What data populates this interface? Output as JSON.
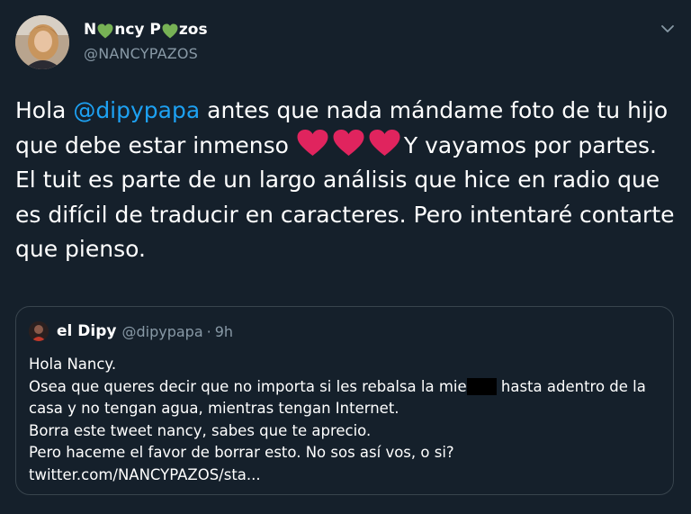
{
  "tweet": {
    "author": {
      "name_part1": "N",
      "name_part2": "ncy P",
      "name_part3": "zos",
      "handle": "@NANCYPAZOS"
    },
    "body": {
      "line1_pre": "Hola ",
      "mention": "@dipypapa",
      "line1_post": " antes que nada mándame foto de tu hijo que debe estar inmenso ",
      "after_hearts": "Y vayamos por partes.",
      "paragraph2": "El tuit es parte de un largo análisis que hice en radio que es difícil de traducir en caracteres. Pero intentaré contarte que pienso."
    },
    "hearts_color": "#e0245e",
    "name_hearts_color": "#77b255"
  },
  "quoted": {
    "name": "el Dipy",
    "handle": "@dipypapa",
    "dot": "·",
    "time": "9h",
    "lines": {
      "l1": "Hola Nancy.",
      "l2_pre": "Osea que queres decir que no importa si les rebalsa la mie",
      "l2_post": " hasta adentro de la casa y no tengan agua, mientras tengan Internet.",
      "l3": "Borra este tweet nancy, sabes que te aprecio.",
      "l4": "Pero haceme el favor de borrar esto. No sos así vos, o si?",
      "l5": "twitter.com/NANCYPAZOS/sta..."
    }
  },
  "colors": {
    "background": "#15202b",
    "text": "#ffffff",
    "secondary": "#8899a6",
    "link": "#1da1f2",
    "border": "#38444d"
  },
  "icons": {
    "menu": "chevron-down-icon",
    "heart": "heart-icon"
  }
}
